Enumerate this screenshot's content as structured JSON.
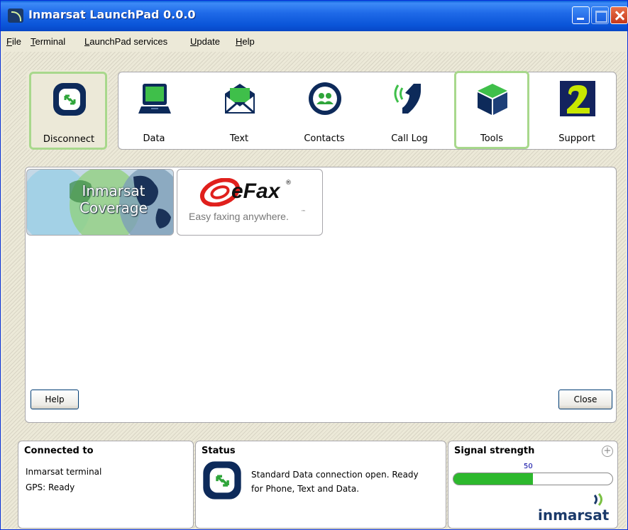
{
  "window": {
    "title": "Inmarsat LaunchPad 0.0.0"
  },
  "menu": {
    "items": [
      "File",
      "Terminal",
      "LaunchPad services",
      "Update",
      "Help"
    ]
  },
  "toolbar": {
    "disconnect": {
      "label": "Disconnect",
      "icon": "disconnect-icon"
    },
    "items": [
      {
        "label": "Data",
        "icon": "laptop-icon"
      },
      {
        "label": "Text",
        "icon": "envelope-icon"
      },
      {
        "label": "Contacts",
        "icon": "contacts-icon"
      },
      {
        "label": "Call Log",
        "icon": "phone-icon"
      },
      {
        "label": "Tools",
        "icon": "tools-cube-icon",
        "selected": true
      },
      {
        "label": "Support",
        "icon": "support-2-icon"
      }
    ]
  },
  "services": {
    "tiles": [
      {
        "label_line1": "Inmarsat",
        "label_line2": "Coverage"
      },
      {
        "brand": "eFax",
        "registered": "®",
        "tagline": "Easy faxing anywhere.",
        "tm": "™"
      }
    ],
    "help_label": "Help",
    "close_label": "Close"
  },
  "status_bar": {
    "connected": {
      "title": "Connected to",
      "line1": "Inmarsat terminal",
      "line2": "GPS: Ready"
    },
    "status": {
      "title": "Status",
      "line1": "Standard Data connection open. Ready",
      "line2": "for Phone, Text and Data."
    },
    "signal": {
      "title": "Signal strength",
      "value_label": "50",
      "value_fraction": 0.5,
      "expand_symbol": "+",
      "logo": "inmarsat"
    }
  },
  "colors": {
    "selected_border": "#a8d88c",
    "signal_fill": "#2db82d",
    "brand_red": "#e0201c",
    "icon_navy": "#0d2a5a"
  }
}
